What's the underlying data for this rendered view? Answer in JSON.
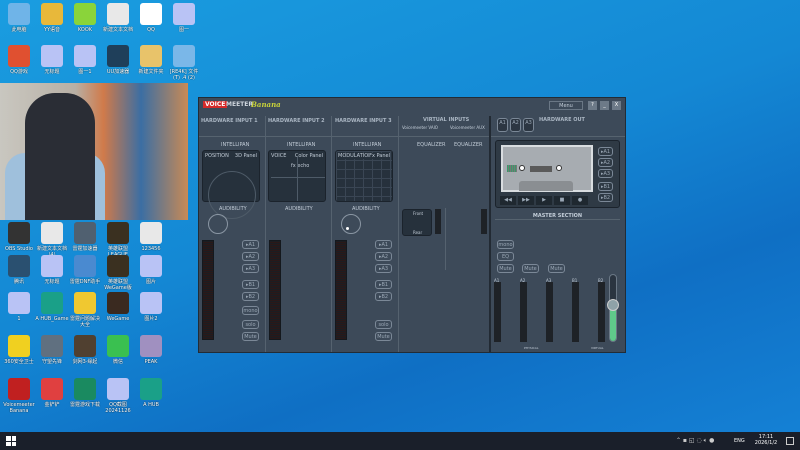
{
  "desktop_icons": [
    {
      "label": "此电脑",
      "color": "#6fb4e8"
    },
    {
      "label": "YY语音",
      "color": "#e8b83a"
    },
    {
      "label": "KOOK",
      "color": "#8ad43a"
    },
    {
      "label": "新建文本文档",
      "color": "#e8e8e8"
    },
    {
      "label": "QQ",
      "color": "#ffffff"
    },
    {
      "label": "图一",
      "color": "#b9c3f5"
    },
    {
      "label": "QQ游戏",
      "color": "#e05030"
    },
    {
      "label": "无标题",
      "color": "#b9c3f5"
    },
    {
      "label": "图一1",
      "color": "#b9c3f5"
    },
    {
      "label": "UU加速器",
      "color": "#1f3f5a"
    },
    {
      "label": "新建文件夹",
      "color": "#e8c36a"
    },
    {
      "label": "[RE4K] 文件(T) .4 (2)",
      "color": "#7ab7e8"
    },
    {
      "label": "OBS Studio",
      "color": "#333333"
    },
    {
      "label": "新建文本文档 (4)",
      "color": "#e8e8e8"
    },
    {
      "label": "雷霆加速器",
      "color": "#506070"
    },
    {
      "label": "英雄联盟 LEAGUE",
      "color": "#3a3020"
    },
    {
      "label": "123456",
      "color": "#e8e8e8"
    },
    {
      "label": "腾讯",
      "color": "#2a5070"
    },
    {
      "label": "无标题",
      "color": "#b9c3f5"
    },
    {
      "label": "雷霆DNF助手",
      "color": "#4a8ad0"
    },
    {
      "label": "英雄联盟 WeGame版",
      "color": "#3a3020"
    },
    {
      "label": "图片",
      "color": "#b9c3f5"
    },
    {
      "label": "1",
      "color": "#b9c3f5"
    },
    {
      "label": "A HUB_Game",
      "color": "#1aa088"
    },
    {
      "label": "雷霆问题解决大全",
      "color": "#f0c830"
    },
    {
      "label": "WeGame",
      "color": "#3a2a20"
    },
    {
      "label": "图片2",
      "color": "#b9c3f5"
    },
    {
      "label": "360安全卫士",
      "color": "#f0d020"
    },
    {
      "label": "守望先锋",
      "color": "#607080"
    },
    {
      "label": "剑网3·缘起",
      "color": "#504030"
    },
    {
      "label": "微信",
      "color": "#3ac050"
    },
    {
      "label": "PEAK",
      "color": "#a090c0"
    },
    {
      "label": "Voicemeeter Banana",
      "color": "#c02020"
    },
    {
      "label": "金铲铲",
      "color": "#e04040"
    },
    {
      "label": "雷霆游戏下载",
      "color": "#1a8a60"
    },
    {
      "label": "QQ截图 20241126",
      "color": "#b9c3f5"
    },
    {
      "label": "A HUB",
      "color": "#1aa088"
    }
  ],
  "voicemeeter": {
    "logo_voice": "VOICE",
    "logo_meeter": "MEETER",
    "logo_edition": "Banana",
    "menu": "Menu",
    "help": "?",
    "minimize": "_",
    "close": "X",
    "strips": [
      {
        "title": "HARDWARE INPUT 1",
        "intellipan": "INTELLIPAN",
        "mode": "POSITION",
        "panel": "3D Panel",
        "audibility": "AUDIBILITY",
        "buses": [
          "▸A1",
          "▸A2",
          "▸A3",
          "▸B1",
          "▸B2"
        ],
        "mono": "mono",
        "solo": "solo",
        "mute": "Mute"
      },
      {
        "title": "HARDWARE INPUT 2",
        "intellipan": "INTELLIPAN",
        "mode": "VOICE",
        "panel": "Color Panel",
        "fx": "fx echo",
        "audibility": "AUDIBILITY"
      },
      {
        "title": "HARDWARE INPUT 3",
        "intellipan": "INTELLIPAN",
        "mode": "MODULATION",
        "panel": "Fx Panel",
        "audibility": "AUDIBILITY",
        "buses": [
          "▸A1",
          "▸A2",
          "▸A3",
          "▸B1",
          "▸B2"
        ],
        "solo": "solo",
        "mute": "Mute"
      }
    ],
    "virtual_inputs": {
      "title": "VIRTUAL INPUTS",
      "names": [
        "Voicemeeter VAIO",
        "Voicemeeter AUX"
      ],
      "eq": "EQUALIZER",
      "front": "Front",
      "rear": "Rear"
    },
    "hardware_out": {
      "title": "HARDWARE OUT",
      "buttons": [
        "A1",
        "A2",
        "A3"
      ]
    },
    "recorder_buses": [
      "▸A1",
      "▸A2",
      "▸A3",
      "▸B1",
      "▸B2"
    ],
    "transport": [
      "◀◀",
      "▶▶",
      "▶",
      "■",
      "●"
    ],
    "master": {
      "title": "MASTER SECTION",
      "mono": "mono",
      "eq": "EQ",
      "mute": "Mute",
      "buses": [
        "A1",
        "A2",
        "A3",
        "B1",
        "B2"
      ],
      "physical": "PHYSICAL",
      "virtual": "VIRTUAL",
      "b2_level": 0.55,
      "accent": "#5fc98a"
    }
  },
  "taskbar": {
    "lang": "ENG",
    "time": "17:11",
    "date": "2026/1/2"
  }
}
